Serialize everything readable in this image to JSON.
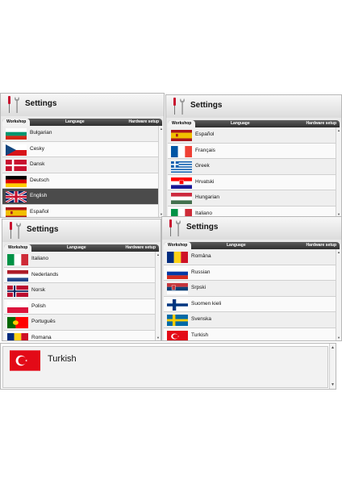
{
  "panels": [
    {
      "title": "Settings",
      "tabs": [
        "Workshop",
        "Language",
        "Hardware setup"
      ],
      "items": [
        {
          "label": "Bulgarian",
          "flag": "bulgaria-flag"
        },
        {
          "label": "Cesky",
          "flag": "czech-flag"
        },
        {
          "label": "Dansk",
          "flag": "denmark-flag"
        },
        {
          "label": "Deutsch",
          "flag": "germany-flag"
        },
        {
          "label": "English",
          "flag": "uk-flag",
          "selected": true
        },
        {
          "label": "Español",
          "flag": "spain-flag"
        }
      ]
    },
    {
      "title": "Settings",
      "tabs": [
        "Workshop",
        "Language",
        "Hardware setup"
      ],
      "items": [
        {
          "label": "Español",
          "flag": "spain-flag"
        },
        {
          "label": "Français",
          "flag": "france-flag"
        },
        {
          "label": "Greek",
          "flag": "greece-flag"
        },
        {
          "label": "Hrvatski",
          "flag": "croatia-flag"
        },
        {
          "label": "Hungarian",
          "flag": "hungary-flag"
        },
        {
          "label": "Italiano",
          "flag": "italy-flag"
        }
      ]
    },
    {
      "title": "Settings",
      "tabs": [
        "Workshop",
        "Language",
        "Hardware setup"
      ],
      "items": [
        {
          "label": "Italiano",
          "flag": "italy-flag"
        },
        {
          "label": "Nederlands",
          "flag": "netherlands-flag"
        },
        {
          "label": "Norsk",
          "flag": "norway-flag"
        },
        {
          "label": "Polish",
          "flag": "poland-flag"
        },
        {
          "label": "Português",
          "flag": "portugal-flag"
        },
        {
          "label": "Romana",
          "flag": "romania-flag"
        }
      ]
    },
    {
      "title": "Settings",
      "tabs": [
        "Workshop",
        "Language",
        "Hardware setup"
      ],
      "items": [
        {
          "label": "Româna",
          "flag": "romania-flag"
        },
        {
          "label": "Russian",
          "flag": "russia-flag"
        },
        {
          "label": "Srpski",
          "flag": "serbia-flag"
        },
        {
          "label": "Suomen kieli",
          "flag": "finland-flag"
        },
        {
          "label": "Svenska",
          "flag": "sweden-flag"
        },
        {
          "label": "Turkish",
          "flag": "turkey-flag"
        }
      ]
    }
  ],
  "featured": {
    "label": "Turkish",
    "flag": "turkey-flag"
  },
  "scroll_glyphs": {
    "up": "▲",
    "down": "▼"
  },
  "colors": {
    "selected_row": "#4b4b4b",
    "tab_bar": "#3a3a3a",
    "panel_bg": "#e9e9e9"
  }
}
